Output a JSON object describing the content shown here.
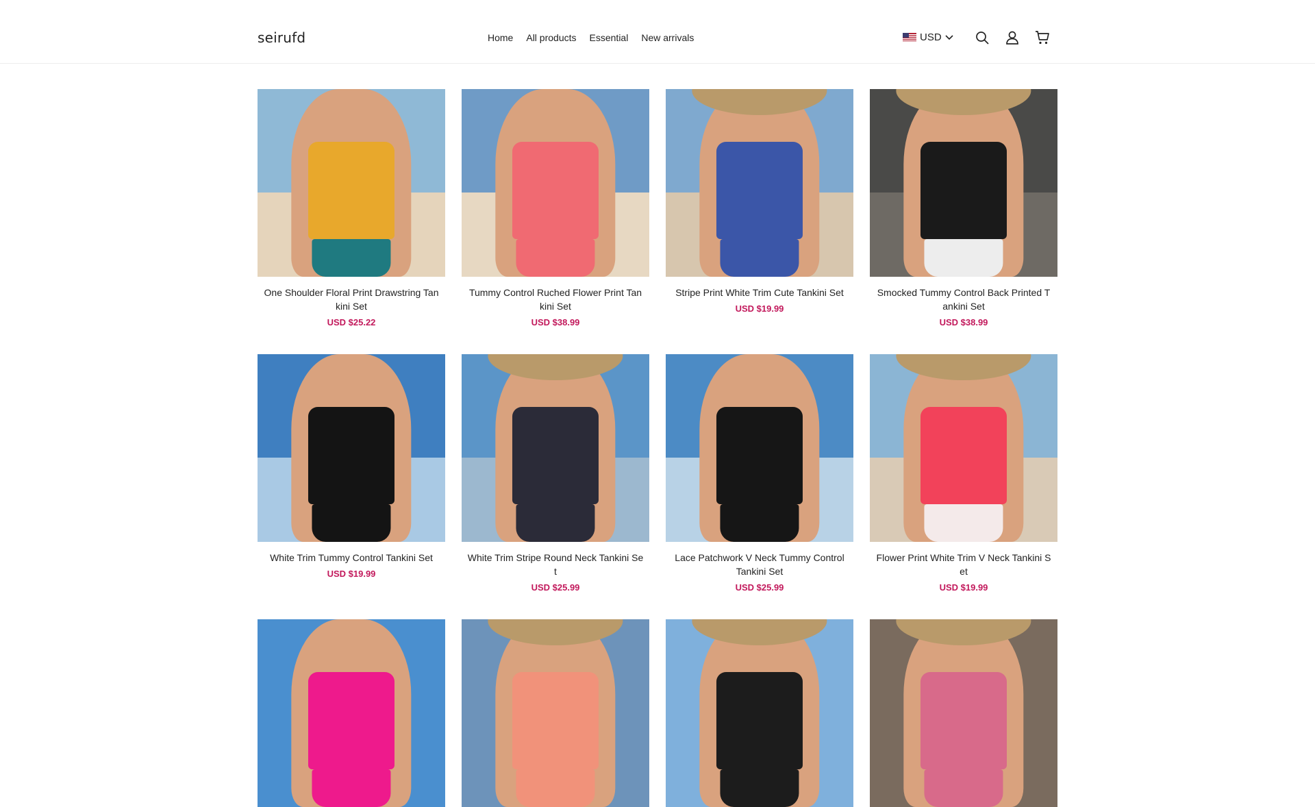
{
  "brand": {
    "name": "seirufd"
  },
  "nav": {
    "items": [
      {
        "label": "Home"
      },
      {
        "label": "All products"
      },
      {
        "label": "Essential"
      },
      {
        "label": "New arrivals"
      }
    ]
  },
  "header": {
    "currency": "USD",
    "icons": [
      "us-flag-icon",
      "chevron-down-icon",
      "search-icon",
      "user-icon",
      "cart-icon"
    ]
  },
  "colors": {
    "accent_price": "#c2185b",
    "text": "#222222",
    "border": "#ececec"
  },
  "products": [
    {
      "title": "One Shoulder Floral Print Drawstring Tankini Set",
      "price": "USD $25.22",
      "suit": "#e8a82c",
      "suit2": "#1f7a80",
      "sky": "#8fb9d6",
      "sand": "#e5d4bb",
      "hat": false
    },
    {
      "title": "Tummy Control Ruched Flower Print Tankini Set",
      "price": "USD $38.99",
      "suit": "#f06a72",
      "suit2": "#f06a72",
      "sky": "#6f9bc6",
      "sand": "#e7d8c2",
      "hat": false
    },
    {
      "title": "Stripe Print White Trim Cute Tankini Set",
      "price": "USD $19.99",
      "suit": "#3b56a8",
      "suit2": "#3b56a8",
      "sky": "#7fa9cf",
      "sand": "#d7c6ae",
      "hat": true
    },
    {
      "title": "Smocked Tummy Control Back Printed Tankini Set",
      "price": "USD $38.99",
      "suit": "#1a1a1a",
      "suit2": "#ededed",
      "sky": "#4a4a48",
      "sand": "#6e6a64",
      "hat": true
    },
    {
      "title": "White Trim Tummy Control Tankini Set",
      "price": "USD $19.99",
      "suit": "#141414",
      "suit2": "#141414",
      "sky": "#3f7fc0",
      "sand": "#a9c9e4",
      "hat": false
    },
    {
      "title": "White Trim Stripe Round Neck Tankini Set",
      "price": "USD $25.99",
      "suit": "#2b2b38",
      "suit2": "#2b2b38",
      "sky": "#5b95c8",
      "sand": "#9cb8cf",
      "hat": true
    },
    {
      "title": "Lace Patchwork V Neck Tummy Control Tankini Set",
      "price": "USD $25.99",
      "suit": "#161616",
      "suit2": "#161616",
      "sky": "#4c8bc5",
      "sand": "#b8d2e6",
      "hat": false
    },
    {
      "title": "Flower Print White Trim V Neck Tankini Set",
      "price": "USD $19.99",
      "suit": "#f2425a",
      "suit2": "#f4eaea",
      "sky": "#8bb5d4",
      "sand": "#d9cab6",
      "hat": true
    },
    {
      "title": "",
      "price": "",
      "suit": "#ee1a8c",
      "suit2": "#ee1a8c",
      "sky": "#4a8fcf",
      "sand": "#4a8fcf",
      "hat": false
    },
    {
      "title": "",
      "price": "",
      "suit": "#f1927a",
      "suit2": "#f1927a",
      "sky": "#6d93ba",
      "sand": "#6d93ba",
      "hat": true
    },
    {
      "title": "",
      "price": "",
      "suit": "#1c1c1c",
      "suit2": "#1c1c1c",
      "sky": "#7fb0dc",
      "sand": "#7fb0dc",
      "hat": true
    },
    {
      "title": "",
      "price": "",
      "suit": "#d86a8a",
      "suit2": "#d86a8a",
      "sky": "#7a6b5e",
      "sand": "#7a6b5e",
      "hat": true
    }
  ]
}
